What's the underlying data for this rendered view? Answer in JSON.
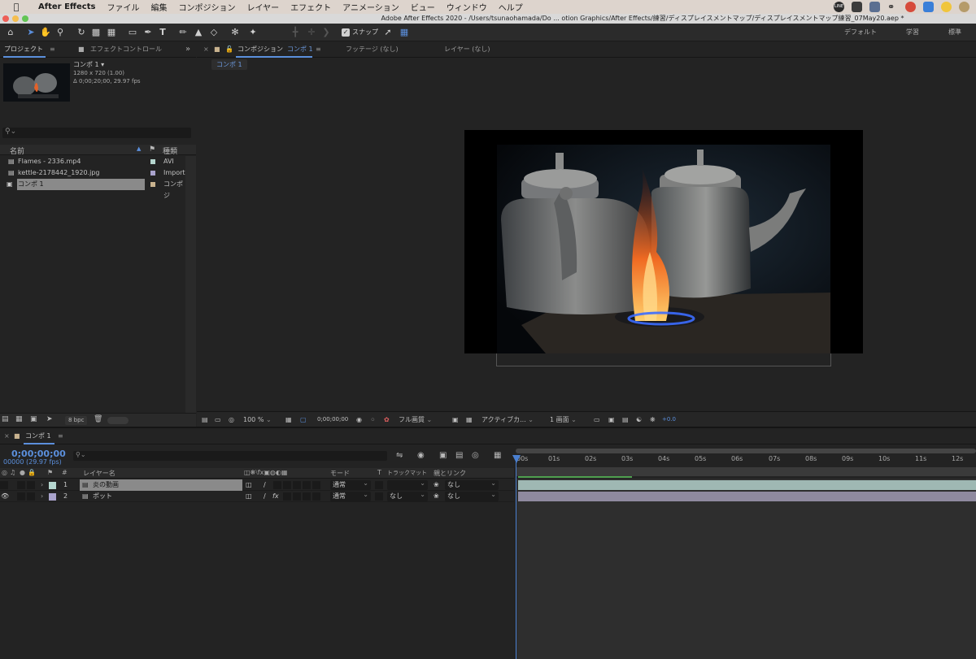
{
  "menubar": {
    "app_name": "After Effects",
    "items": [
      "ファイル",
      "編集",
      "コンポジション",
      "レイヤー",
      "エフェクト",
      "アニメーション",
      "ビュー",
      "ウィンドウ",
      "ヘルプ"
    ],
    "tray_line": "LINE"
  },
  "window": {
    "title": "Adobe After Effects 2020 - /Users/tsunaohamada/Do ... otion Graphics/After Effects/練習/ディスプレイスメントマップ/ディスプレイスメントマップ練習_07May20.aep *"
  },
  "toolbar": {
    "snap_label": "スナップ",
    "workspaces": [
      "デフォルト",
      "学習",
      "標準"
    ]
  },
  "project_panel": {
    "tab_project": "プロジェクト",
    "tab_effects": "エフェクトコントロール",
    "comp_name": "コンポ 1 ▾",
    "comp_size": "1280 x 720 (1.00)",
    "comp_duration": "Δ 0;00;20;00, 29.97 fps",
    "col_name": "名前",
    "col_type": "種類",
    "items": [
      {
        "name": "Flames - 2336.mp4",
        "type": "AVI",
        "color": "#b5d6cf"
      },
      {
        "name": "kettle-2178442_1920.jpg",
        "type": "Import",
        "color": "#a9a3cc"
      },
      {
        "name": "コンポ 1",
        "type": "コンポジ",
        "color": "#c9b38f"
      }
    ],
    "bpc": "8 bpc"
  },
  "comp_panel": {
    "tab_comp_prefix": "コンポジション",
    "tab_comp_name": "コンポ 1",
    "tab_footage": "フッテージ (なし)",
    "tab_layer": "レイヤー (なし)",
    "subtab": "コンポ 1",
    "zoom": "100 %",
    "timecode": "0;00;00;00",
    "resolution": "フル画質",
    "camera": "アクティブカ...",
    "views": "1 画面",
    "exposure": "+0.0"
  },
  "timeline": {
    "tab": "コンポ 1",
    "timecode": "0;00;00;00",
    "frames": "00000 (29.97 fps)",
    "columns": {
      "number": "#",
      "layer_name": "レイヤー名",
      "mode": "モード",
      "t": "T",
      "track_matte": "トラックマット",
      "parent": "親とリンク"
    },
    "ticks": [
      "00s",
      "01s",
      "02s",
      "03s",
      "04s",
      "05s",
      "06s",
      "07s",
      "08s",
      "09s",
      "10s",
      "11s",
      "12s"
    ],
    "layers": [
      {
        "num": "1",
        "name": "炎の動画",
        "mode": "通常",
        "matte": "",
        "parent": "なし",
        "color": "#b5d6cf"
      },
      {
        "num": "2",
        "name": "ポット",
        "mode": "通常",
        "matte": "なし",
        "parent": "なし",
        "color": "#a9a3cc"
      }
    ]
  }
}
